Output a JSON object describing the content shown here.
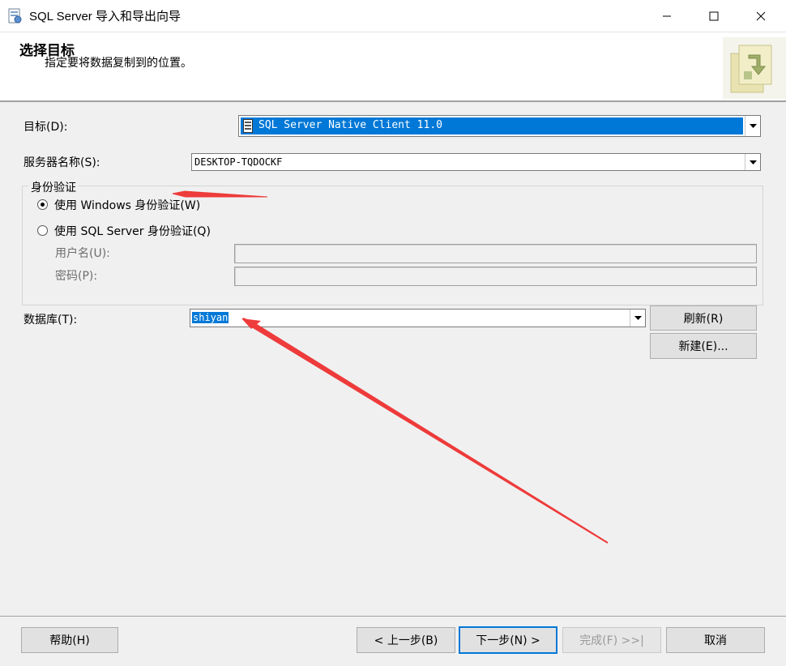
{
  "window": {
    "title": "SQL Server 导入和导出向导",
    "minimize_icon": "minimize-icon",
    "maximize_icon": "maximize-icon",
    "close_icon": "close-icon"
  },
  "header": {
    "title": "选择目标",
    "subtitle": "指定要将数据复制到的位置。"
  },
  "form": {
    "destination": {
      "label": "目标(D):",
      "value": "SQL Server Native Client 11.0"
    },
    "server": {
      "label": "服务器名称(S):",
      "value": "DESKTOP-TQDOCKF"
    },
    "auth_group": {
      "legend": "身份验证",
      "windows_label": "使用 Windows 身份验证(W)",
      "sql_label": "使用 SQL Server 身份验证(Q)",
      "selected": "windows",
      "username_label": "用户名(U):",
      "username_value": "",
      "password_label": "密码(P):",
      "password_value": ""
    },
    "database": {
      "label": "数据库(T):",
      "value": "shiyan"
    },
    "refresh_button": "刷新(R)",
    "new_button": "新建(E)..."
  },
  "footer": {
    "help": "帮助(H)",
    "back": "< 上一步(B)",
    "next": "下一步(N) >",
    "finish": "完成(F) >>|",
    "cancel": "取消"
  },
  "colors": {
    "selection": "#0078d7",
    "annotation_arrow": "#ee3b3b"
  }
}
